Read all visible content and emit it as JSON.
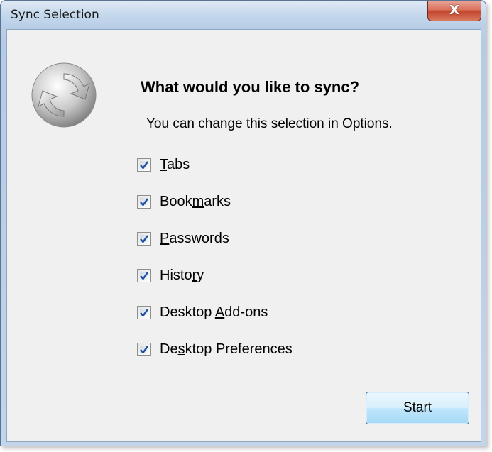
{
  "window": {
    "title": "Sync Selection",
    "close_glyph": "X"
  },
  "dialog": {
    "heading": "What would you like to sync?",
    "subtitle": "You can change this selection in Options.",
    "options": [
      {
        "pre": "",
        "acc": "T",
        "post": "abs",
        "checked": true
      },
      {
        "pre": "Book",
        "acc": "m",
        "post": "arks",
        "checked": true
      },
      {
        "pre": "",
        "acc": "P",
        "post": "asswords",
        "checked": true
      },
      {
        "pre": "Histo",
        "acc": "r",
        "post": "y",
        "checked": true
      },
      {
        "pre": "Desktop ",
        "acc": "A",
        "post": "dd-ons",
        "checked": true
      },
      {
        "pre": "De",
        "acc": "s",
        "post": "ktop Preferences",
        "checked": true
      }
    ],
    "start_label": "Start"
  },
  "icons": {
    "logo": "sync-logo-icon",
    "close": "close-icon",
    "check": "check-icon"
  },
  "colors": {
    "accent": "#3c7fb1",
    "close_red": "#c2472e",
    "check_blue": "#1f4ea1"
  }
}
